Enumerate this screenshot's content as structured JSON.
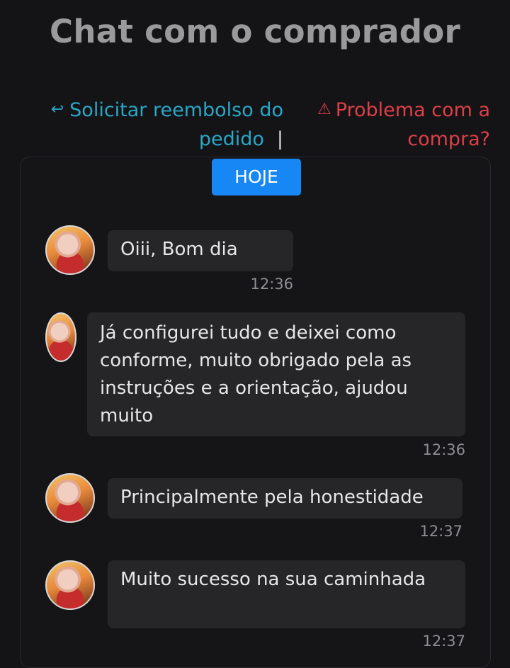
{
  "header": {
    "title": "Chat com o comprador"
  },
  "actions": {
    "refund_icon": "↩",
    "refund_label": "Solicitar reembolso do pedido",
    "separator": "|",
    "problem_icon": "⚠",
    "problem_label": "Problema com a compra?"
  },
  "colors": {
    "refund": "#2aa6c7",
    "problem": "#dd3f47",
    "badge": "#1787f5"
  },
  "chat": {
    "date_badge": "HOJE",
    "messages": [
      {
        "text": "Oiii, Bom dia",
        "time": "12:36"
      },
      {
        "text": "Já configurei tudo e deixei como conforme, muito obrigado pela as instruções e a orientação, ajudou muito",
        "time": "12:36"
      },
      {
        "text": "Principalmente pela honestidade",
        "time": "12:37"
      },
      {
        "text": "Muito sucesso na sua caminhada",
        "time": "12:37"
      }
    ]
  },
  "icons": {
    "avatar": "user-avatar",
    "refund": "undo-arrow-icon",
    "problem": "warning-triangle-icon"
  }
}
